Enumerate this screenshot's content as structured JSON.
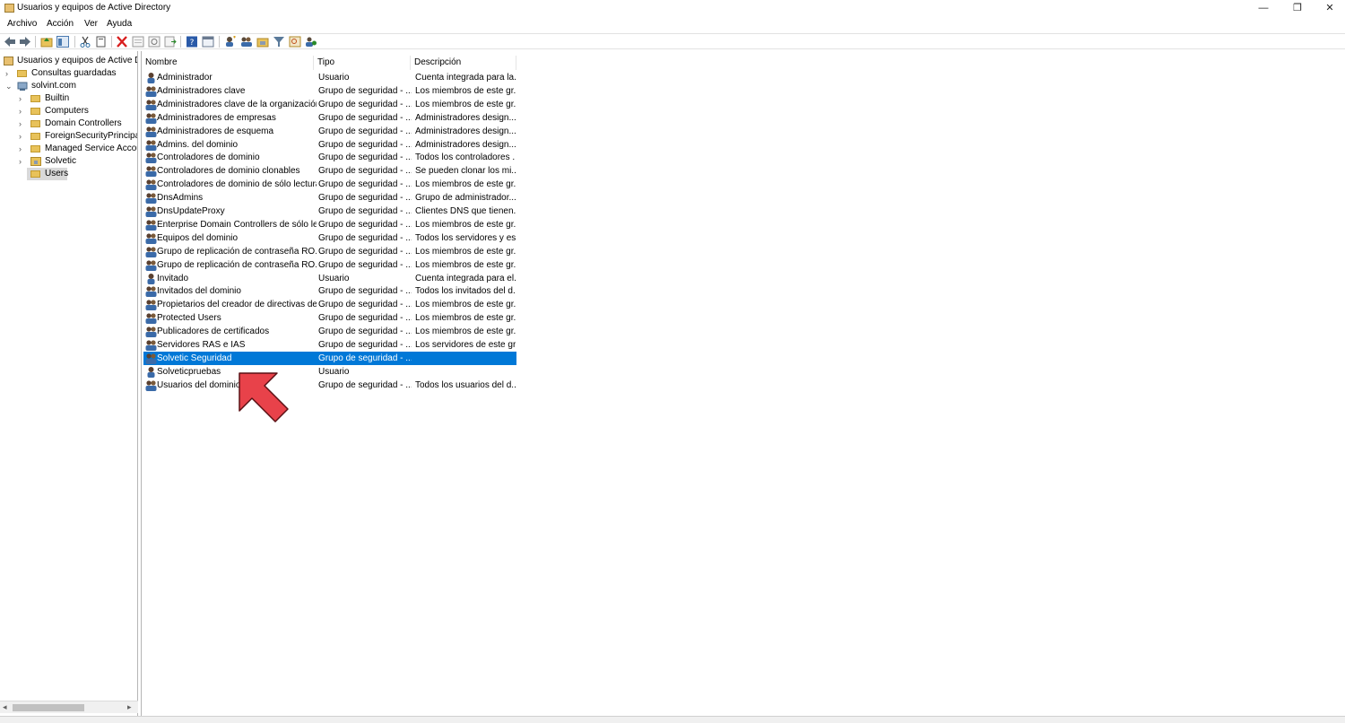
{
  "window": {
    "title": "Usuarios y equipos de Active Directory",
    "minimize_glyph": "—",
    "restore_glyph": "❐",
    "close_glyph": "✕"
  },
  "menu": [
    "Archivo",
    "Acción",
    "Ver",
    "Ayuda"
  ],
  "toolbar": {
    "icons": [
      "back-icon",
      "forward-icon",
      "up-folder-icon",
      "show-console-tree-icon",
      "cut-icon",
      "copy-icon",
      "delete-icon",
      "properties-icon",
      "refresh-icon",
      "export-list-icon",
      "help-icon",
      "view-icon",
      "new-user-icon",
      "new-group-icon",
      "new-ou-icon",
      "filter-icon",
      "find-icon",
      "add-to-group-icon"
    ]
  },
  "tree": {
    "root": "Usuarios y equipos de Active Directory",
    "saved_queries": "Consultas guardadas",
    "domain": "solvint.com",
    "containers": [
      "Builtin",
      "Computers",
      "Domain Controllers",
      "ForeignSecurityPrincipals",
      "Managed Service Accounts",
      "Solvetic",
      "Users"
    ],
    "selected": "Users"
  },
  "list": {
    "columns": [
      "Nombre",
      "Tipo",
      "Descripción"
    ],
    "rows": [
      {
        "icon": "user-icon",
        "name": "Administrador",
        "type": "Usuario",
        "desc": "Cuenta integrada para la..."
      },
      {
        "icon": "group-icon",
        "name": "Administradores clave",
        "type": "Grupo de seguridad - ...",
        "desc": "Los miembros de este gr..."
      },
      {
        "icon": "group-icon",
        "name": "Administradores clave de la organización",
        "type": "Grupo de seguridad - ...",
        "desc": "Los miembros de este gr..."
      },
      {
        "icon": "group-icon",
        "name": "Administradores de empresas",
        "type": "Grupo de seguridad - ...",
        "desc": "Administradores design..."
      },
      {
        "icon": "group-icon",
        "name": "Administradores de esquema",
        "type": "Grupo de seguridad - ...",
        "desc": "Administradores design..."
      },
      {
        "icon": "group-icon",
        "name": "Admins. del dominio",
        "type": "Grupo de seguridad - ...",
        "desc": "Administradores design..."
      },
      {
        "icon": "group-icon",
        "name": "Controladores de dominio",
        "type": "Grupo de seguridad - ...",
        "desc": "Todos los controladores ..."
      },
      {
        "icon": "group-icon",
        "name": "Controladores de dominio clonables",
        "type": "Grupo de seguridad - ...",
        "desc": "Se pueden clonar los mi..."
      },
      {
        "icon": "group-icon",
        "name": "Controladores de dominio de sólo lectura",
        "type": "Grupo de seguridad - ...",
        "desc": "Los miembros de este gr..."
      },
      {
        "icon": "group-icon",
        "name": "DnsAdmins",
        "type": "Grupo de seguridad - ...",
        "desc": "Grupo de administrador..."
      },
      {
        "icon": "group-icon",
        "name": "DnsUpdateProxy",
        "type": "Grupo de seguridad - ...",
        "desc": "Clientes DNS que tienen..."
      },
      {
        "icon": "group-icon",
        "name": "Enterprise Domain Controllers de sólo le...",
        "type": "Grupo de seguridad - ...",
        "desc": "Los miembros de este gr..."
      },
      {
        "icon": "group-icon",
        "name": "Equipos del dominio",
        "type": "Grupo de seguridad - ...",
        "desc": "Todos los servidores y es..."
      },
      {
        "icon": "group-icon",
        "name": "Grupo de replicación de contraseña RO...",
        "type": "Grupo de seguridad - ...",
        "desc": "Los miembros de este gr..."
      },
      {
        "icon": "group-icon",
        "name": "Grupo de replicación de contraseña RO...",
        "type": "Grupo de seguridad - ...",
        "desc": "Los miembros de este gr..."
      },
      {
        "icon": "user-icon",
        "name": "Invitado",
        "type": "Usuario",
        "desc": "Cuenta integrada para el..."
      },
      {
        "icon": "group-icon",
        "name": "Invitados del dominio",
        "type": "Grupo de seguridad - ...",
        "desc": "Todos los invitados del d..."
      },
      {
        "icon": "group-icon",
        "name": "Propietarios del creador de directivas de...",
        "type": "Grupo de seguridad - ...",
        "desc": "Los miembros de este gr..."
      },
      {
        "icon": "group-icon",
        "name": "Protected Users",
        "type": "Grupo de seguridad - ...",
        "desc": "Los miembros de este gr..."
      },
      {
        "icon": "group-icon",
        "name": "Publicadores de certificados",
        "type": "Grupo de seguridad - ...",
        "desc": "Los miembros de este gr..."
      },
      {
        "icon": "group-icon",
        "name": "Servidores RAS e IAS",
        "type": "Grupo de seguridad - ...",
        "desc": "Los servidores de este gr..."
      },
      {
        "icon": "group-icon",
        "name": "Solvetic Seguridad",
        "type": "Grupo de seguridad - ...",
        "desc": "",
        "selected": true
      },
      {
        "icon": "user-icon",
        "name": "Solveticpruebas",
        "type": "Usuario",
        "desc": ""
      },
      {
        "icon": "group-icon",
        "name": "Usuarios del dominio",
        "type": "Grupo de seguridad - ...",
        "desc": "Todos los usuarios del d..."
      }
    ]
  },
  "colors": {
    "selection": "#0078d7",
    "annotation_arrow": "#e8424a"
  }
}
